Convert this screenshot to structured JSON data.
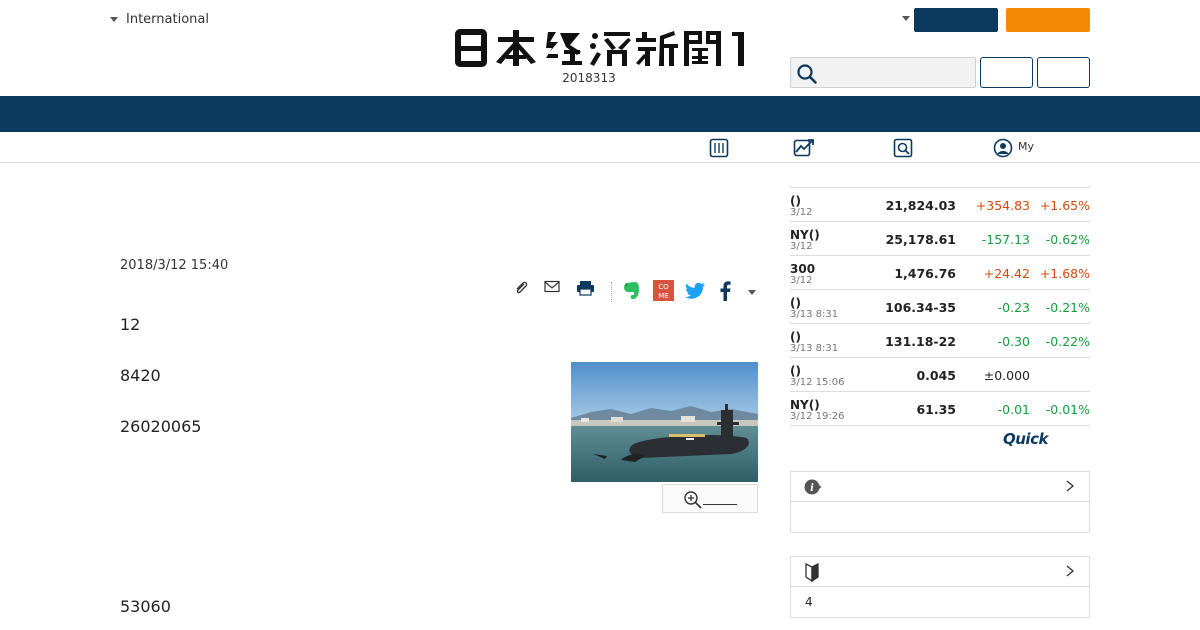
{
  "header": {
    "edition_label": "International",
    "date": "2018313"
  },
  "subnav": {
    "my_label": "My"
  },
  "article": {
    "date": "2018/3/12 15:40",
    "paragraphs": [
      "12",
      "8420",
      "26020065",
      "53060"
    ]
  },
  "market": {
    "rows": [
      {
        "name": "()",
        "time": "3/12",
        "price": "21,824.03",
        "change": "+354.83",
        "pct": "+1.65%",
        "dir": "up"
      },
      {
        "name": "NY()",
        "time": "3/12",
        "price": "25,178.61",
        "change": "-157.13",
        "pct": "-0.62%",
        "dir": "down"
      },
      {
        "name": "300",
        "time": "3/12",
        "price": "1,476.76",
        "change": "+24.42",
        "pct": "+1.68%",
        "dir": "up"
      },
      {
        "name": "()",
        "time": "3/13 8:31",
        "price": "106.34-35",
        "change": "-0.23",
        "pct": "-0.21%",
        "dir": "down"
      },
      {
        "name": "()",
        "time": "3/13 8:31",
        "price": "131.18-22",
        "change": "-0.30",
        "pct": "-0.22%",
        "dir": "down"
      },
      {
        "name": "()",
        "time": "3/12 15:06",
        "price": "0.045",
        "change": "±0.000",
        "pct": "",
        "dir": "flat"
      },
      {
        "name": "NY()",
        "time": "3/12 19:26",
        "price": "61.35",
        "change": "-0.01",
        "pct": "-0.01%",
        "dir": "down"
      }
    ],
    "source_logo": "Quick"
  },
  "sidebox2": {
    "body_text": "4"
  },
  "colors": {
    "navy": "#0b3a5e",
    "orange": "#f58a07",
    "up": "#d24a0b",
    "down": "#169c3a"
  }
}
